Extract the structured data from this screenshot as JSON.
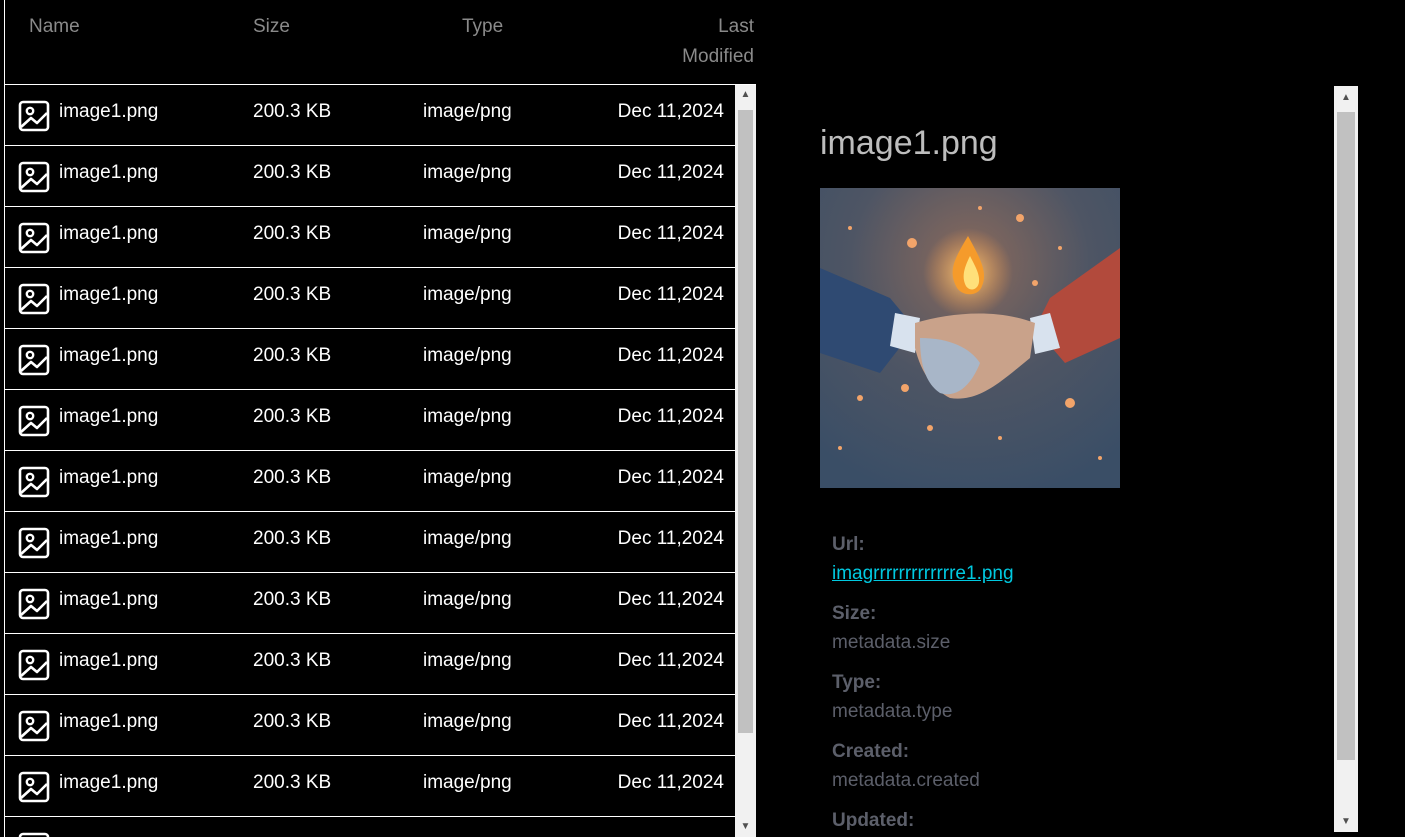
{
  "columns": {
    "name": "Name",
    "size": "Size",
    "type": "Type",
    "modified_line1": "Last",
    "modified_line2": "Modified"
  },
  "files": [
    {
      "name": "image1.png",
      "size": "200.3 KB",
      "type": "image/png",
      "modified": "Dec 11,2024"
    },
    {
      "name": "image1.png",
      "size": "200.3 KB",
      "type": "image/png",
      "modified": "Dec 11,2024"
    },
    {
      "name": "image1.png",
      "size": "200.3 KB",
      "type": "image/png",
      "modified": "Dec 11,2024"
    },
    {
      "name": "image1.png",
      "size": "200.3 KB",
      "type": "image/png",
      "modified": "Dec 11,2024"
    },
    {
      "name": "image1.png",
      "size": "200.3 KB",
      "type": "image/png",
      "modified": "Dec 11,2024"
    },
    {
      "name": "image1.png",
      "size": "200.3 KB",
      "type": "image/png",
      "modified": "Dec 11,2024"
    },
    {
      "name": "image1.png",
      "size": "200.3 KB",
      "type": "image/png",
      "modified": "Dec 11,2024"
    },
    {
      "name": "image1.png",
      "size": "200.3 KB",
      "type": "image/png",
      "modified": "Dec 11,2024"
    },
    {
      "name": "image1.png",
      "size": "200.3 KB",
      "type": "image/png",
      "modified": "Dec 11,2024"
    },
    {
      "name": "image1.png",
      "size": "200.3 KB",
      "type": "image/png",
      "modified": "Dec 11,2024"
    },
    {
      "name": "image1.png",
      "size": "200.3 KB",
      "type": "image/png",
      "modified": "Dec 11,2024"
    },
    {
      "name": "image1.png",
      "size": "200.3 KB",
      "type": "image/png",
      "modified": "Dec 11,2024"
    },
    {
      "name": "",
      "size": "",
      "type": "",
      "modified": ""
    }
  ],
  "file_icon": "image-file-icon",
  "details": {
    "title": "image1.png",
    "preview_icon": "handshake-flame-illustration",
    "url_label": "Url:",
    "url_value": "imagrrrrrrrrrrrrre1.png",
    "size_label": "Size:",
    "size_value": "metadata.size",
    "type_label": "Type:",
    "type_value": "metadata.type",
    "created_label": "Created:",
    "created_value": "metadata.created",
    "updated_label": "Updated:"
  },
  "colors": {
    "background": "#000000",
    "link": "#00c9e0",
    "meta_text": "#5c5f6a",
    "header_text": "#8a8a8a"
  }
}
